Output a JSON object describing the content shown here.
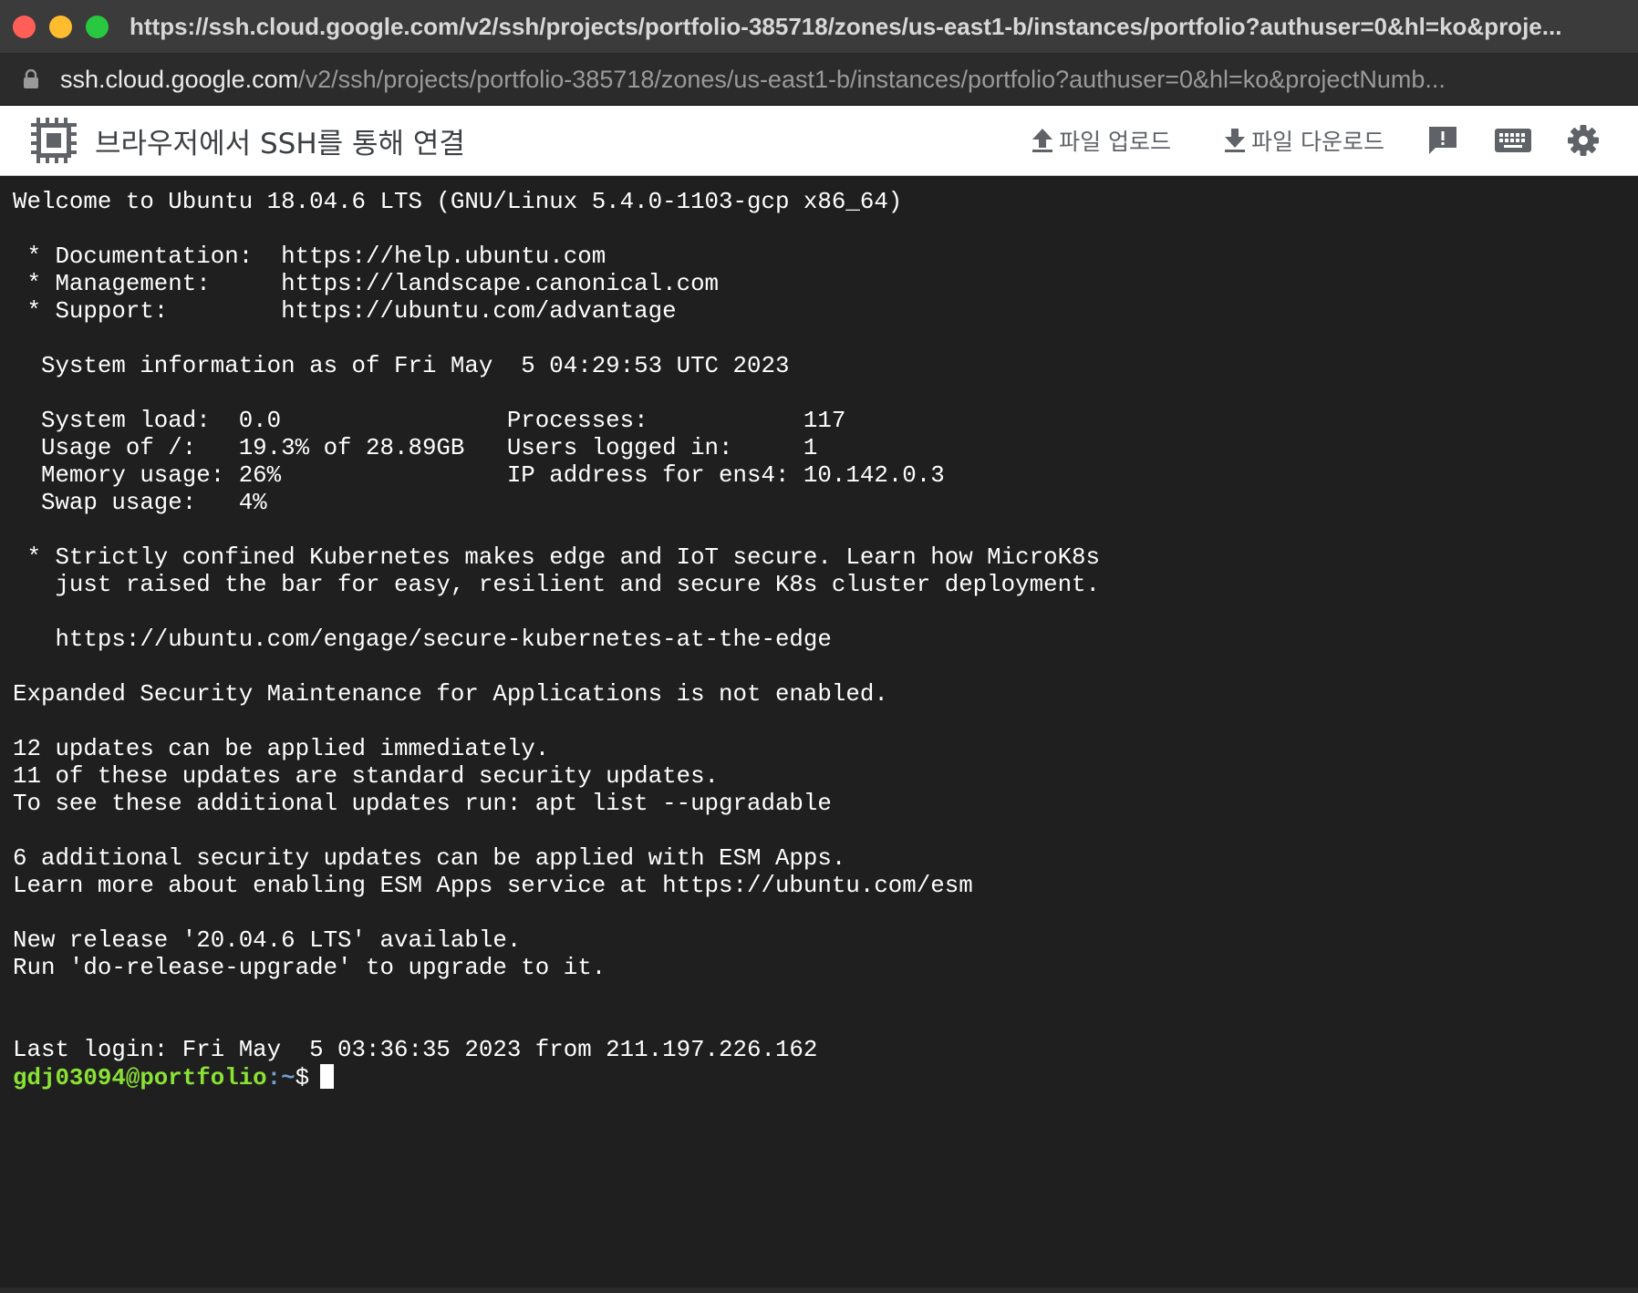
{
  "window": {
    "title": "https://ssh.cloud.google.com/v2/ssh/projects/portfolio-385718/zones/us-east1-b/instances/portfolio?authuser=0&hl=ko&proje...",
    "url_host": "ssh.cloud.google.com",
    "url_path": "/v2/ssh/projects/portfolio-385718/zones/us-east1-b/instances/portfolio?authuser=0&hl=ko&projectNumb..."
  },
  "toolbar": {
    "title": "브라우저에서 SSH를 통해 연결",
    "upload_label": "파일 업로드",
    "download_label": "파일 다운로드",
    "icons": [
      "chip-icon",
      "upload-icon",
      "download-icon",
      "feedback-icon",
      "keyboard-icon",
      "gear-icon"
    ]
  },
  "terminal": {
    "lines": [
      "Welcome to Ubuntu 18.04.6 LTS (GNU/Linux 5.4.0-1103-gcp x86_64)",
      "",
      " * Documentation:  https://help.ubuntu.com",
      " * Management:     https://landscape.canonical.com",
      " * Support:        https://ubuntu.com/advantage",
      "",
      "  System information as of Fri May  5 04:29:53 UTC 2023",
      "",
      "  System load:  0.0                Processes:           117",
      "  Usage of /:   19.3% of 28.89GB   Users logged in:     1",
      "  Memory usage: 26%                IP address for ens4: 10.142.0.3",
      "  Swap usage:   4%",
      "",
      " * Strictly confined Kubernetes makes edge and IoT secure. Learn how MicroK8s",
      "   just raised the bar for easy, resilient and secure K8s cluster deployment.",
      "",
      "   https://ubuntu.com/engage/secure-kubernetes-at-the-edge",
      "",
      "Expanded Security Maintenance for Applications is not enabled.",
      "",
      "12 updates can be applied immediately.",
      "11 of these updates are standard security updates.",
      "To see these additional updates run: apt list --upgradable",
      "",
      "6 additional security updates can be applied with ESM Apps.",
      "Learn more about enabling ESM Apps service at https://ubuntu.com/esm",
      "",
      "New release '20.04.6 LTS' available.",
      "Run 'do-release-upgrade' to upgrade to it.",
      "",
      "",
      "Last login: Fri May  5 03:36:35 2023 from 211.197.226.162"
    ],
    "prompt_user": "gdj03094@portfolio",
    "prompt_path": ":~",
    "prompt_symbol": "$",
    "colors": {
      "background": "#1f1f1f",
      "text": "#ffffff",
      "prompt_user": "#8ae234",
      "prompt_path": "#729fcf"
    }
  }
}
